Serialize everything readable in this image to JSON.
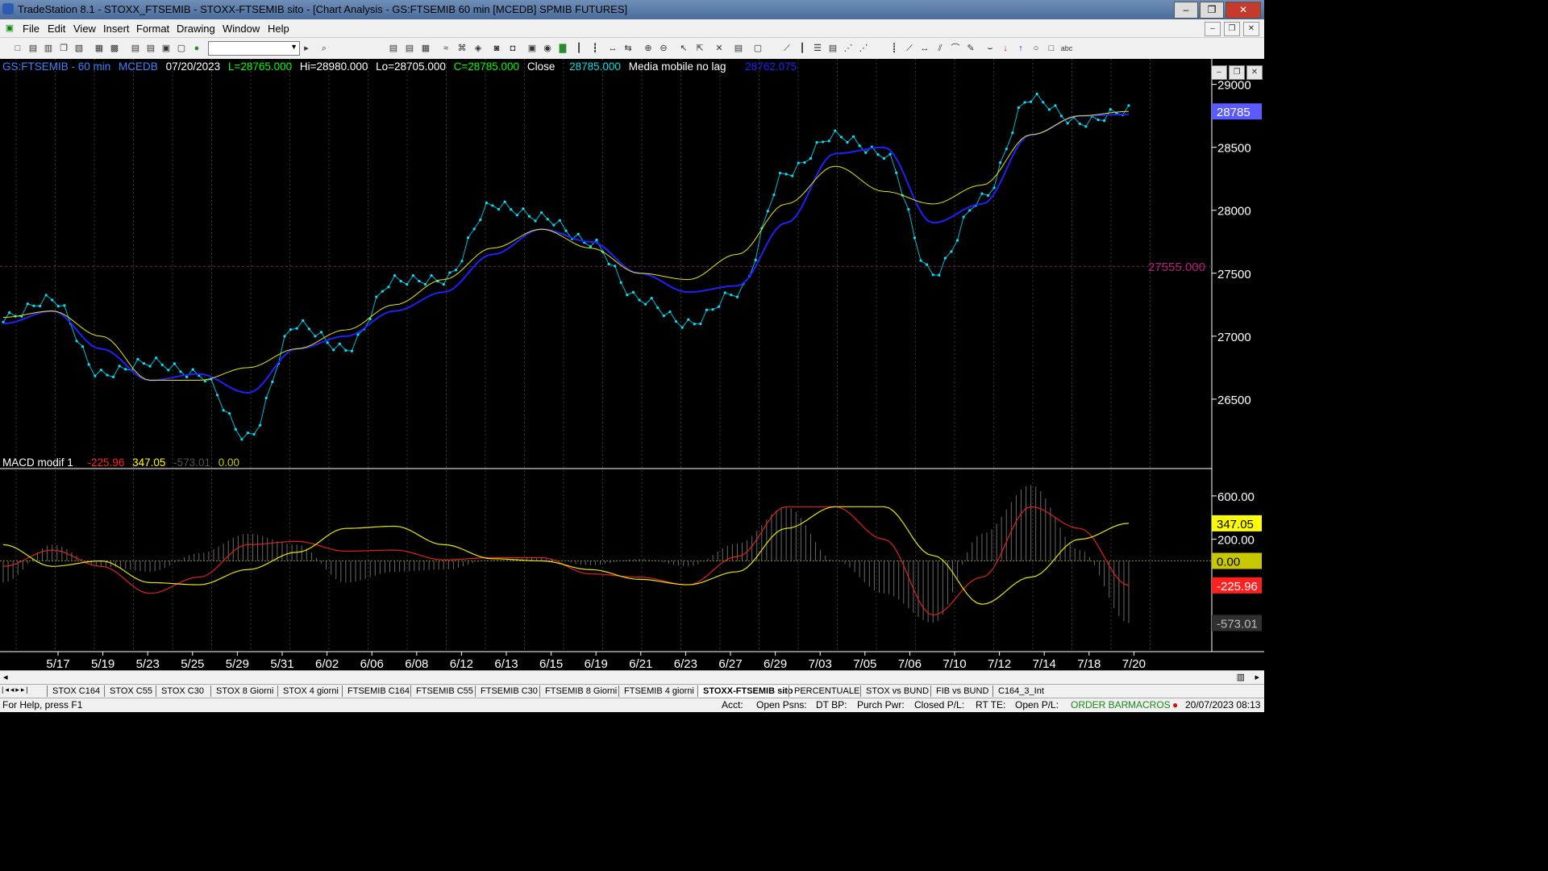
{
  "window": {
    "title": "TradeStation 8.1 - STOXX_FTSEMIB - STOXX-FTSEMIB sito - [Chart Analysis - GS:FTSEMIB  60 min  [MCEDB] SPMIB FUTURES]",
    "minimize_label": "‒",
    "maximize_label": "❐",
    "close_label": "✕"
  },
  "menu": {
    "items": [
      "File",
      "Edit",
      "View",
      "Insert",
      "Format",
      "Drawing",
      "Window",
      "Help"
    ],
    "doc_minimize": "‒",
    "doc_restore": "❐",
    "doc_close": "✕"
  },
  "header": {
    "symbol": "GS:FTSEMIB - 60 min",
    "data_name": "MCEDB",
    "date": "07/20/2023",
    "low": "L=28765.000",
    "hi": "Hi=28980.000",
    "lo": "Lo=28705.000",
    "close": "C=28785.000",
    "close_label": "Close",
    "close_value": "28785.000",
    "indicator_name": "Media mobile no lag",
    "indicator_value": "28762.075",
    "colors": {
      "symbol": "#3b82ff",
      "date": "#ffffff",
      "low": "#00ff00",
      "hi": "#ffffff",
      "lo": "#ffffff",
      "close": "#00ff00",
      "close_value": "#00e0e0",
      "indicator_value": "#2020ff"
    }
  },
  "macd_header": {
    "name": "MACD modif 1",
    "v1": "-225.96",
    "v2": "347.05",
    "v3": "-573.01",
    "v4": "0.00",
    "colors": {
      "v1": "#ff2020",
      "v2": "#ffff00",
      "v3": "#505050",
      "v4": "#c8c800"
    }
  },
  "price_axis": {
    "ticks": [
      "29000",
      "28500",
      "28000",
      "27500",
      "27000",
      "26500"
    ],
    "last_price_label": "28785",
    "reference_label": "27555.000"
  },
  "macd_axis": {
    "ticks": [
      "600.00",
      "200.00"
    ],
    "labels": {
      "yellow": "347.05",
      "zero": "0.00",
      "red": "-225.96",
      "gray": "-573.01"
    }
  },
  "date_axis": [
    "5/17",
    "5/19",
    "5/23",
    "5/25",
    "5/29",
    "5/31",
    "6/02",
    "6/06",
    "6/08",
    "6/12",
    "6/13",
    "6/15",
    "6/19",
    "6/21",
    "6/23",
    "6/27",
    "6/29",
    "7/03",
    "7/05",
    "7/06",
    "7/10",
    "7/12",
    "7/14",
    "7/18",
    "7/20"
  ],
  "chart_data": {
    "type": "line",
    "title": "",
    "x": [
      "5/17",
      "5/19",
      "5/23",
      "5/25",
      "5/29",
      "5/31",
      "6/02",
      "6/06",
      "6/08",
      "6/12",
      "6/13",
      "6/15",
      "6/19",
      "6/21",
      "6/23",
      "6/27",
      "6/29",
      "7/03",
      "7/05",
      "7/06",
      "7/10",
      "7/12",
      "7/14",
      "7/18"
    ],
    "series": [
      {
        "name": "",
        "color": "#00e5ff",
        "values": [
          27150,
          27300,
          26700,
          26800,
          26700,
          26200,
          27100,
          26900,
          27450,
          27450,
          28050,
          27950,
          27750,
          27300,
          27100,
          27350,
          28300,
          28600,
          28450,
          27500,
          28100,
          28900,
          28700,
          28800
        ]
      },
      {
        "name": "Media mobile no lag",
        "color": "#2020ff",
        "values": [
          27100,
          27200,
          26900,
          26650,
          26700,
          26550,
          26900,
          27000,
          27200,
          27350,
          27650,
          27850,
          27750,
          27500,
          27350,
          27400,
          27900,
          28450,
          28500,
          27900,
          28050,
          28600,
          28750,
          28762
        ]
      },
      {
        "name": "",
        "color": "#e8e800",
        "values": [
          27150,
          27200,
          27000,
          26650,
          26650,
          26750,
          26900,
          27050,
          27250,
          27450,
          27700,
          27850,
          27700,
          27500,
          27450,
          27650,
          28050,
          28350,
          28150,
          28050,
          28200,
          28600,
          28750,
          28785
        ]
      }
    ],
    "macd": {
      "x": [
        "5/17",
        "5/19",
        "5/23",
        "5/25",
        "5/29",
        "5/31",
        "6/02",
        "6/06",
        "6/08",
        "6/12",
        "6/13",
        "6/15",
        "6/19",
        "6/21",
        "6/23",
        "6/27",
        "6/29",
        "7/03",
        "7/05",
        "7/06",
        "7/10",
        "7/12",
        "7/14",
        "7/18"
      ],
      "line_red": [
        -50,
        100,
        -50,
        -300,
        -150,
        150,
        180,
        90,
        100,
        10,
        30,
        30,
        -120,
        -150,
        -220,
        40,
        500,
        500,
        200,
        -500,
        -150,
        500,
        300,
        -225.96
      ],
      "line_yellow": [
        150,
        -50,
        0,
        -200,
        -220,
        -80,
        80,
        300,
        320,
        150,
        20,
        0,
        -80,
        -170,
        -220,
        -100,
        300,
        500,
        500,
        50,
        -400,
        -150,
        200,
        347.05
      ],
      "histogram": [
        -200,
        150,
        -50,
        -100,
        70,
        250,
        150,
        -200,
        -100,
        -80,
        10,
        30,
        -40,
        20,
        -50,
        160,
        500,
        0,
        -300,
        -573,
        250,
        700,
        100,
        -573.01
      ],
      "ylim": [
        -800,
        800
      ]
    },
    "ylim": [
      26000,
      29100
    ],
    "reference_level": 27555
  },
  "tabs": [
    "STOX C164",
    "STOX C55",
    "STOX  C30",
    "STOX  8 Giorni",
    "STOX 4 giorni",
    "FTSEMIB C164",
    "FTSEMIB C55",
    "FTSEMIB C30",
    "FTSEMIB  8 Giorni",
    "FTSEMIB  4 giorni",
    "STOXX-FTSEMIB sito",
    "PERCENTUALE",
    "STOX vs BUND",
    "FIB vs BUND",
    "C164_3_Int"
  ],
  "active_tab": "STOXX-FTSEMIB sito",
  "status": {
    "help": "For Help, press F1",
    "acct": "Acct:",
    "open_psns": "Open Psns:",
    "dt_bp": "DT BP:",
    "purch_pwr": "Purch Pwr:",
    "closed_pl": "Closed P/L:",
    "rt_te": "RT TE:",
    "open_pl": "Open P/L:",
    "order_bar": "ORDER BAR",
    "macros": "MACROS",
    "datetime": "20/07/2023 08:13"
  }
}
